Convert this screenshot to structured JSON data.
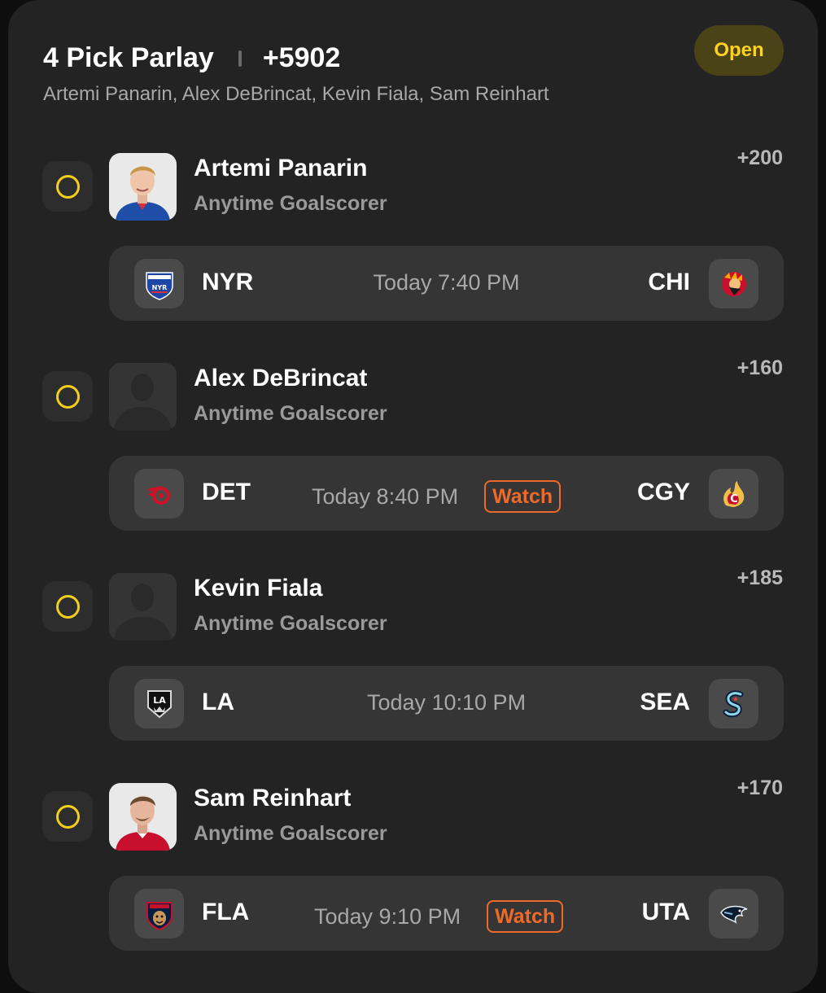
{
  "parlay": {
    "title": "4 Pick Parlay",
    "odds": "+5902",
    "status": "Open",
    "players_summary": "Artemi Panarin, Alex DeBrincat, Kevin Fiala, Sam Reinhart"
  },
  "legs": [
    {
      "player": "Artemi Panarin",
      "market": "Anytime Goalscorer",
      "odds": "+200",
      "avatar": "player-photo",
      "game": {
        "home": "NYR",
        "away": "CHI",
        "time": "Today 7:40 PM",
        "watch": null,
        "home_logo": "rangers-logo-icon",
        "away_logo": "blackhawks-logo-icon"
      }
    },
    {
      "player": "Alex DeBrincat",
      "market": "Anytime Goalscorer",
      "odds": "+160",
      "avatar": "silhouette",
      "game": {
        "home": "DET",
        "away": "CGY",
        "time": "Today 8:40 PM",
        "watch": "Watch",
        "home_logo": "red-wings-logo-icon",
        "away_logo": "flames-logo-icon"
      }
    },
    {
      "player": "Kevin Fiala",
      "market": "Anytime Goalscorer",
      "odds": "+185",
      "avatar": "silhouette",
      "game": {
        "home": "LA",
        "away": "SEA",
        "time": "Today 10:10 PM",
        "watch": null,
        "home_logo": "kings-logo-icon",
        "away_logo": "kraken-logo-icon"
      }
    },
    {
      "player": "Sam Reinhart",
      "market": "Anytime Goalscorer",
      "odds": "+170",
      "avatar": "player-photo",
      "game": {
        "home": "FLA",
        "away": "UTA",
        "time": "Today 9:10 PM",
        "watch": "Watch",
        "home_logo": "panthers-logo-icon",
        "away_logo": "utah-logo-icon"
      }
    }
  ],
  "colors": {
    "card_bg": "#232323",
    "bar_bg": "#353535",
    "accent_yellow": "#f2cf1a",
    "watch_orange": "#ee6a2a"
  }
}
